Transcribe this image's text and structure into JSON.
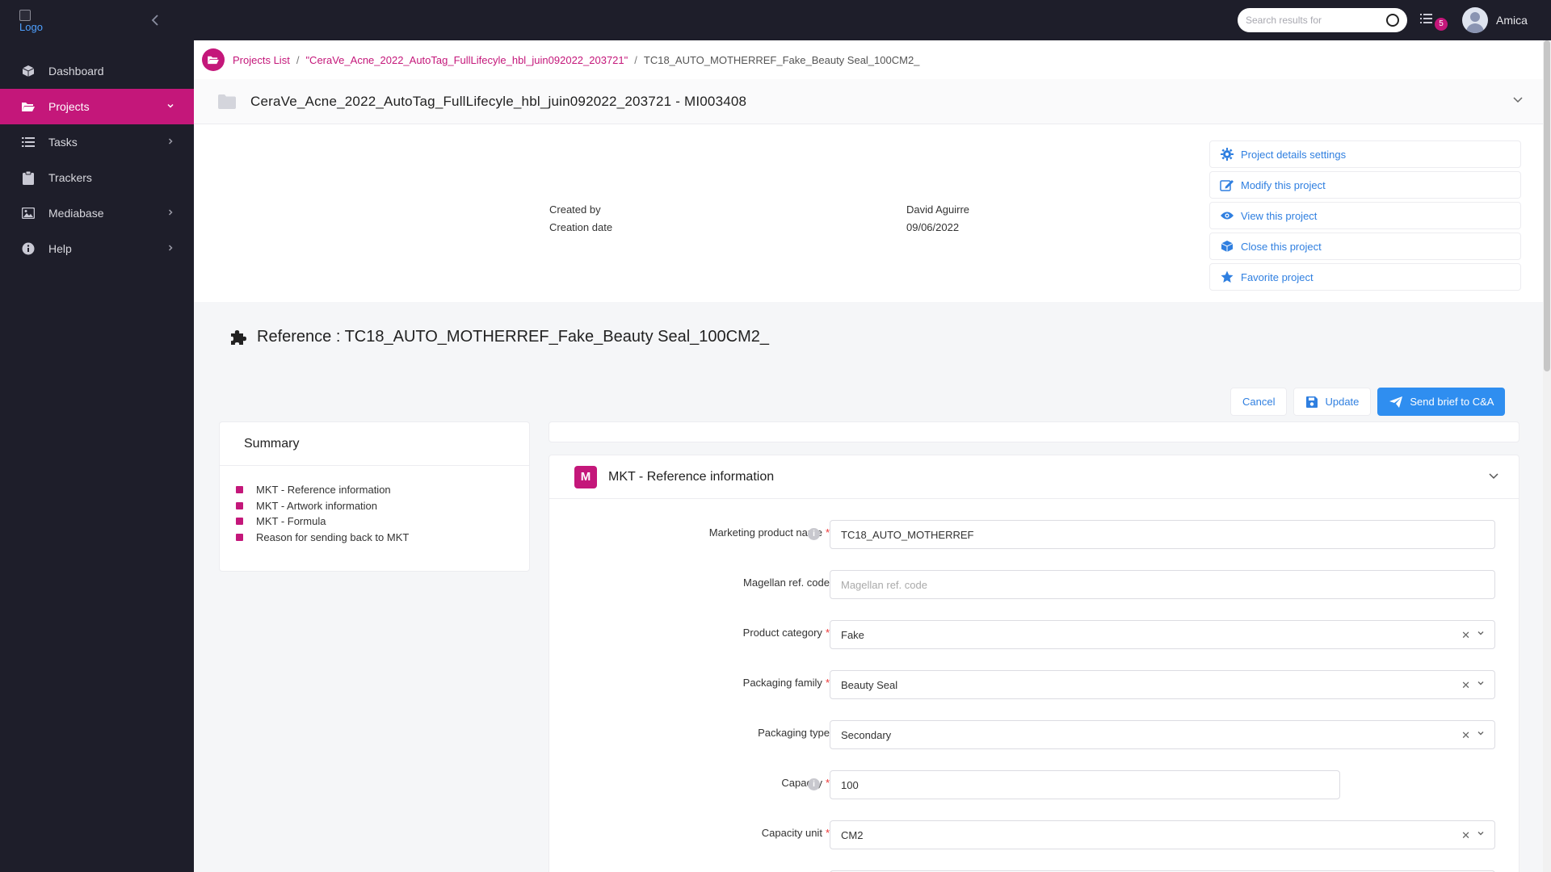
{
  "app": {
    "logo_text": "Logo",
    "user_name": "Amica",
    "notification_count": "5",
    "search_placeholder": "Search results for"
  },
  "sidebar": {
    "items": [
      {
        "label": "Dashboard",
        "icon": "cube-icon",
        "has_chevron": false,
        "active": false
      },
      {
        "label": "Projects",
        "icon": "folder-open-icon",
        "has_chevron": true,
        "active": true
      },
      {
        "label": "Tasks",
        "icon": "list-icon",
        "has_chevron": true,
        "active": false
      },
      {
        "label": "Trackers",
        "icon": "clipboard-icon",
        "has_chevron": false,
        "active": false
      },
      {
        "label": "Mediabase",
        "icon": "image-icon",
        "has_chevron": true,
        "active": false
      },
      {
        "label": "Help",
        "icon": "info-icon",
        "has_chevron": true,
        "active": false
      }
    ]
  },
  "breadcrumb": {
    "root": "Projects List",
    "project": "\"CeraVe_Acne_2022_AutoTag_FullLifecyle_hbl_juin092022_203721\"",
    "current": "TC18_AUTO_MOTHERREF_Fake_Beauty Seal_100CM2_"
  },
  "project": {
    "title": "CeraVe_Acne_2022_AutoTag_FullLifecyle_hbl_juin092022_203721 - MI003408",
    "created_by_label": "Created by",
    "creation_date_label": "Creation date",
    "created_by": "David Aguirre",
    "creation_date": "09/06/2022",
    "actions": [
      {
        "label": "Project details settings",
        "icon": "gear-icon"
      },
      {
        "label": "Modify this project",
        "icon": "edit-icon"
      },
      {
        "label": "View this project",
        "icon": "eye-icon"
      },
      {
        "label": "Close this project",
        "icon": "box-icon"
      },
      {
        "label": "Favorite project",
        "icon": "star-icon"
      }
    ]
  },
  "reference": {
    "title": "Reference : TC18_AUTO_MOTHERREF_Fake_Beauty Seal_100CM2_",
    "buttons": {
      "cancel": "Cancel",
      "update": "Update",
      "send": "Send brief to C&A"
    }
  },
  "summary": {
    "title": "Summary",
    "items": [
      "MKT - Reference information",
      "MKT - Artwork information",
      "MKT - Formula",
      "Reason for sending back to MKT"
    ]
  },
  "form": {
    "section_badge": "M",
    "section_title": "MKT - Reference information",
    "fields": {
      "marketing_product_name": {
        "label": "Marketing product name",
        "value": "TC18_AUTO_MOTHERREF",
        "required": true,
        "info": true
      },
      "magellan_ref_code": {
        "label": "Magellan ref. code",
        "placeholder": "Magellan ref. code",
        "value": "",
        "required": false
      },
      "product_category": {
        "label": "Product category",
        "value": "Fake",
        "required": true
      },
      "packaging_family": {
        "label": "Packaging family",
        "value": "Beauty Seal",
        "required": true
      },
      "packaging_type": {
        "label": "Packaging type",
        "value": "Secondary",
        "required": false
      },
      "capacity": {
        "label": "Capacity",
        "value": "100",
        "required": true,
        "info": true
      },
      "capacity_unit": {
        "label": "Capacity unit",
        "value": "CM2",
        "required": true
      }
    },
    "required_mark": "*",
    "info_mark": "i",
    "clear_mark": "✕",
    "dropdown_mark": "⌄"
  },
  "colors": {
    "brand": "#c4177a",
    "link": "#2f7fe0",
    "primary_button": "#2f8ef0",
    "sidebar_bg": "#1e1e2a"
  }
}
